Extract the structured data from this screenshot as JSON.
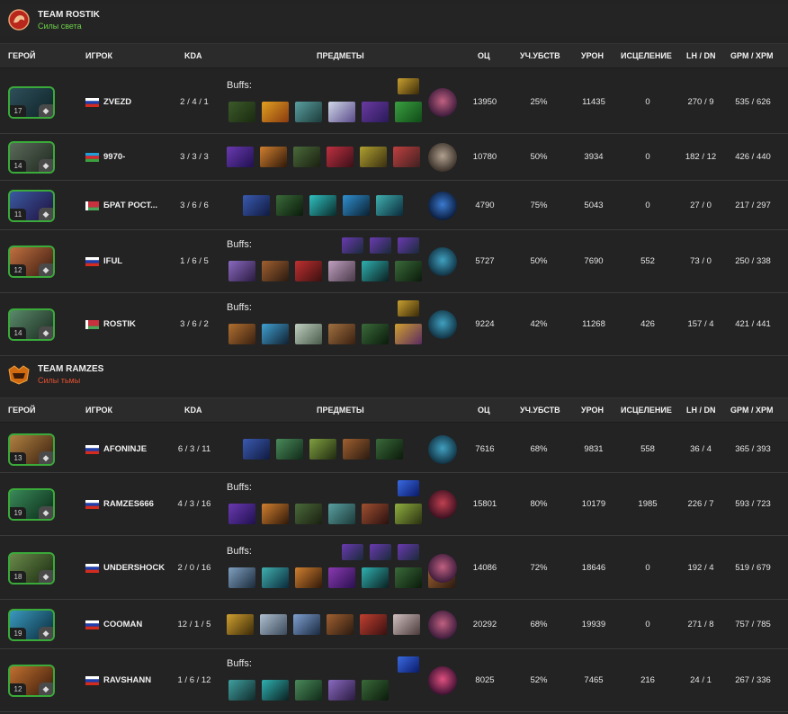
{
  "columns": {
    "hero": "ГЕРОЙ",
    "player": "ИГРОК",
    "kda": "KDA",
    "items": "ПРЕДМЕТЫ",
    "nw": "ОЦ",
    "part": "УЧ.УБСТВ",
    "dmg": "УРОН",
    "heal": "ИСЦЕЛЕНИЕ",
    "lhdn": "LH / DN",
    "gpm": "GPM / XPM"
  },
  "buffs_label": "Buffs:",
  "teams": [
    {
      "name": "TEAM ROSTIK",
      "side": "Силы света",
      "side_color": "#6ccf4a",
      "logo_icon": "rostik-team-logo-icon",
      "players": [
        {
          "level": "17",
          "role_icon": "hourglass-role-icon",
          "hero_colors": [
            "#2e4f5a",
            "#0f2328"
          ],
          "flag": "ru",
          "name": "ZVEZD",
          "kda": "2 / 4 / 1",
          "buffs": [
            "aghanim-shard-buff-icon"
          ],
          "items": [
            {
              "icon": "staff-item-icon",
              "c": [
                "#3c5a2a",
                "#1a2a10"
              ]
            },
            {
              "icon": "daedalus-item-icon",
              "c": [
                "#e0a020",
                "#8a3a10"
              ]
            },
            {
              "icon": "axe-item-icon",
              "c": [
                "#5aa0a0",
                "#1c3a3a"
              ]
            },
            {
              "icon": "blade-item-icon",
              "c": [
                "#d0d8e8",
                "#5a4a8a"
              ]
            },
            {
              "icon": "boots-item-icon",
              "c": [
                "#6a3aa0",
                "#2a1a5a"
              ]
            },
            {
              "icon": "sword-item-icon",
              "c": [
                "#3aa040",
                "#104a18"
              ]
            }
          ],
          "neutral": {
            "icon": "die-neutral-icon",
            "c": [
              "#c06080",
              "#3a1a3a"
            ]
          },
          "nw": "13950",
          "part": "25%",
          "dmg": "11435",
          "heal": "0",
          "lhdn": "270 / 9",
          "gpm": "535 / 626"
        },
        {
          "level": "14",
          "role_icon": "gear-role-icon",
          "hero_colors": [
            "#5a6a5a",
            "#202820"
          ],
          "flag": "az",
          "name": "9970-",
          "kda": "3 / 3 / 3",
          "buffs": [],
          "items": [
            {
              "icon": "boots-item-icon",
              "c": [
                "#6a3ab0",
                "#201050"
              ]
            },
            {
              "icon": "torch-item-icon",
              "c": [
                "#d08030",
                "#301808"
              ]
            },
            {
              "icon": "staff-item-icon",
              "c": [
                "#4a6a3a",
                "#1a2010"
              ]
            },
            {
              "icon": "mask-item-icon",
              "c": [
                "#c03040",
                "#3a1018"
              ]
            },
            {
              "icon": "helm-item-icon",
              "c": [
                "#b0a030",
                "#3a3010"
              ]
            },
            {
              "icon": "hammer-item-icon",
              "c": [
                "#c04040",
                "#402020"
              ]
            }
          ],
          "neutral": {
            "icon": "stone-neutral-icon",
            "c": [
              "#b0a090",
              "#3a3028"
            ]
          },
          "nw": "10780",
          "part": "50%",
          "dmg": "3934",
          "heal": "0",
          "lhdn": "182 / 12",
          "gpm": "426 / 440"
        },
        {
          "level": "11",
          "role_icon": "circle-role-icon",
          "hero_colors": [
            "#3a5aa0",
            "#201040"
          ],
          "flag": "by",
          "name": "БРАТ РОСТ...",
          "kda": "3 / 6 / 6",
          "buffs": [],
          "items": [
            {
              "icon": "boots-item-icon",
              "c": [
                "#3a5ab0",
                "#101a40"
              ]
            },
            {
              "icon": "staff-item-icon",
              "c": [
                "#3a6a3a",
                "#0a1a0a"
              ]
            },
            {
              "icon": "orb-item-icon",
              "c": [
                "#30c0c0",
                "#0a2a2a"
              ]
            },
            {
              "icon": "glimmer-item-icon",
              "c": [
                "#3090d0",
                "#0a2030"
              ]
            },
            {
              "icon": "wind-item-icon",
              "c": [
                "#40b0b0",
                "#0a2a3a"
              ]
            }
          ],
          "neutral": {
            "icon": "potion-neutral-icon",
            "c": [
              "#3a7ad0",
              "#0a1a3a"
            ]
          },
          "nw": "4790",
          "part": "75%",
          "dmg": "5043",
          "heal": "0",
          "lhdn": "27 / 0",
          "gpm": "217 / 297"
        },
        {
          "level": "12",
          "role_icon": "bar-role-icon",
          "hero_colors": [
            "#c07040",
            "#3a1a10"
          ],
          "flag": "ru",
          "name": "IFUL",
          "kda": "1 / 6 / 5",
          "buffs": [
            "rune-buff-icon",
            "orb-buff-icon",
            "mask-buff-icon"
          ],
          "items": [
            {
              "icon": "dagger-item-icon",
              "c": [
                "#8a6ac0",
                "#2a1a40"
              ]
            },
            {
              "icon": "boots-item-icon",
              "c": [
                "#a06030",
                "#2a1a10"
              ]
            },
            {
              "icon": "claw-item-icon",
              "c": [
                "#c03030",
                "#3a1010"
              ]
            },
            {
              "icon": "cloak-item-icon",
              "c": [
                "#c0a0c0",
                "#4a3a4a"
              ]
            },
            {
              "icon": "orb-item-icon",
              "c": [
                "#30b0b0",
                "#0a2020"
              ]
            },
            {
              "icon": "staff-item-icon",
              "c": [
                "#3a6a3a",
                "#0a1a0a"
              ]
            }
          ],
          "neutral": {
            "icon": "lantern-neutral-icon",
            "c": [
              "#40a0c0",
              "#103040"
            ]
          },
          "nw": "5727",
          "part": "50%",
          "dmg": "7690",
          "heal": "552",
          "lhdn": "73 / 0",
          "gpm": "250 / 338"
        },
        {
          "level": "14",
          "role_icon": "pen-role-icon",
          "hero_colors": [
            "#5a8a6a",
            "#1a2a20"
          ],
          "flag": "by",
          "name": "ROSTIK",
          "kda": "3 / 6 / 2",
          "buffs": [
            "aghanim-shard-buff-icon"
          ],
          "items": [
            {
              "icon": "boots-item-icon",
              "c": [
                "#b07030",
                "#3a2010"
              ]
            },
            {
              "icon": "gem-item-icon",
              "c": [
                "#40a0d0",
                "#102030"
              ]
            },
            {
              "icon": "scroll-item-icon",
              "c": [
                "#c0d0c0",
                "#4a5a4a"
              ]
            },
            {
              "icon": "belt-item-icon",
              "c": [
                "#a07040",
                "#3a2010"
              ]
            },
            {
              "icon": "staff-item-icon",
              "c": [
                "#3a6a3a",
                "#0a1a0a"
              ]
            },
            {
              "icon": "bottle-item-icon",
              "c": [
                "#d0a030",
                "#5a2a60"
              ]
            }
          ],
          "neutral": {
            "icon": "lantern-neutral-icon",
            "c": [
              "#40a0c0",
              "#103040"
            ]
          },
          "nw": "9224",
          "part": "42%",
          "dmg": "11268",
          "heal": "426",
          "lhdn": "157 / 4",
          "gpm": "421 / 441"
        }
      ]
    },
    {
      "name": "TEAM RAMZES",
      "side": "Силы тьмы",
      "side_color": "#e05030",
      "logo_icon": "ramzes-team-logo-icon",
      "players": [
        {
          "level": "13",
          "role_icon": "fire-role-icon",
          "hero_colors": [
            "#b08040",
            "#3a2010"
          ],
          "flag": "ru",
          "name": "AFONINJE",
          "kda": "6 / 3 / 11",
          "buffs": [],
          "items": [
            {
              "icon": "boots-item-icon",
              "c": [
                "#3a5ab0",
                "#101a40"
              ]
            },
            {
              "icon": "shield-item-icon",
              "c": [
                "#4a8a5a",
                "#102a18"
              ]
            },
            {
              "icon": "helm-item-icon",
              "c": [
                "#80a040",
                "#202a10"
              ]
            },
            {
              "icon": "boots-item-icon",
              "c": [
                "#a06030",
                "#2a1a10"
              ]
            },
            {
              "icon": "staff-item-icon",
              "c": [
                "#3a6a3a",
                "#0a1a0a"
              ]
            }
          ],
          "neutral": {
            "icon": "lantern-neutral-icon",
            "c": [
              "#40a0c0",
              "#103040"
            ]
          },
          "nw": "7616",
          "part": "68%",
          "dmg": "9831",
          "heal": "558",
          "lhdn": "36 / 4",
          "gpm": "365 / 393"
        },
        {
          "level": "19",
          "role_icon": "climb-role-icon",
          "hero_colors": [
            "#3a8a5a",
            "#0a2a18"
          ],
          "flag": "ru",
          "name": "RAMZES666",
          "kda": "4 / 3 / 16",
          "buffs": [
            "scepter-buff-icon"
          ],
          "items": [
            {
              "icon": "boots-item-icon",
              "c": [
                "#6a3ab0",
                "#201050"
              ]
            },
            {
              "icon": "torch-item-icon",
              "c": [
                "#d08030",
                "#301808"
              ]
            },
            {
              "icon": "staff-item-icon",
              "c": [
                "#4a6a3a",
                "#1a2010"
              ]
            },
            {
              "icon": "axe-item-icon",
              "c": [
                "#5aa0a0",
                "#1c3a3a"
              ]
            },
            {
              "icon": "mask-item-icon",
              "c": [
                "#a05030",
                "#2a1010"
              ]
            },
            {
              "icon": "helm-item-icon",
              "c": [
                "#90b040",
                "#2a3010"
              ]
            }
          ],
          "neutral": {
            "icon": "cape-neutral-icon",
            "c": [
              "#c04050",
              "#3a1020"
            ]
          },
          "nw": "15801",
          "part": "80%",
          "dmg": "10179",
          "heal": "1985",
          "lhdn": "226 / 7",
          "gpm": "593 / 723"
        },
        {
          "level": "18",
          "role_icon": "leaf-role-icon",
          "hero_colors": [
            "#6a8a4a",
            "#1a2a10"
          ],
          "flag": "ru",
          "name": "UNDERSHOCK",
          "kda": "2 / 0 / 16",
          "buffs": [
            "claw-buff-icon",
            "hammer-buff-icon",
            "gem-buff-icon"
          ],
          "items": [
            {
              "icon": "mace-item-icon",
              "c": [
                "#80a0c0",
                "#1a2a3a"
              ]
            },
            {
              "icon": "wind-item-icon",
              "c": [
                "#40b0b0",
                "#0a2a3a"
              ]
            },
            {
              "icon": "torch-item-icon",
              "c": [
                "#d08030",
                "#301808"
              ]
            },
            {
              "icon": "blade-item-icon",
              "c": [
                "#8a3ab0",
                "#2a1050"
              ]
            },
            {
              "icon": "orb-item-icon",
              "c": [
                "#30b0b0",
                "#0a2020"
              ]
            },
            {
              "icon": "staff-item-icon",
              "c": [
                "#3a6a3a",
                "#0a1a0a"
              ]
            },
            {
              "icon": "boots-item-icon",
              "c": [
                "#a06030",
                "#2a1a10"
              ]
            }
          ],
          "neutral": {
            "icon": "die-neutral-icon",
            "c": [
              "#c06080",
              "#3a1a3a"
            ]
          },
          "nw": "14086",
          "part": "72%",
          "dmg": "18646",
          "heal": "0",
          "lhdn": "192 / 4",
          "gpm": "519 / 679"
        },
        {
          "level": "19",
          "role_icon": "check-role-icon",
          "hero_colors": [
            "#3a9ac0",
            "#0a2a3a"
          ],
          "flag": "ru",
          "name": "COOMAN",
          "kda": "12 / 1 / 5",
          "buffs": [],
          "items": [
            {
              "icon": "helm-item-icon",
              "c": [
                "#d0a030",
                "#3a2a08"
              ]
            },
            {
              "icon": "orb-item-icon",
              "c": [
                "#b0c0d0",
                "#3a4a5a"
              ]
            },
            {
              "icon": "blade-item-icon",
              "c": [
                "#80a0d0",
                "#1a2a40"
              ]
            },
            {
              "icon": "boots-item-icon",
              "c": [
                "#a06030",
                "#2a1a10"
              ]
            },
            {
              "icon": "claw-item-icon",
              "c": [
                "#c04030",
                "#3a1010"
              ]
            },
            {
              "icon": "mask-item-icon",
              "c": [
                "#d0c0c0",
                "#4a3a3a"
              ]
            }
          ],
          "neutral": {
            "icon": "die-neutral-icon",
            "c": [
              "#c06080",
              "#3a1a3a"
            ]
          },
          "nw": "20292",
          "part": "68%",
          "dmg": "19939",
          "heal": "0",
          "lhdn": "271 / 8",
          "gpm": "757 / 785"
        },
        {
          "level": "12",
          "role_icon": "flask-role-icon",
          "hero_colors": [
            "#c07030",
            "#3a1a0a"
          ],
          "flag": "ru",
          "name": "RAVSHANN",
          "kda": "1 / 6 / 12",
          "buffs": [
            "scepter-buff-icon"
          ],
          "items": [
            {
              "icon": "lantern-item-icon",
              "c": [
                "#40a0a0",
                "#102a2a"
              ]
            },
            {
              "icon": "orb-item-icon",
              "c": [
                "#30b0b0",
                "#0a2020"
              ]
            },
            {
              "icon": "shield-item-icon",
              "c": [
                "#4a8a5a",
                "#102a18"
              ]
            },
            {
              "icon": "dagger-item-icon",
              "c": [
                "#8a6ac0",
                "#2a1a40"
              ]
            },
            {
              "icon": "staff-item-icon",
              "c": [
                "#3a6a3a",
                "#0a1a0a"
              ]
            }
          ],
          "neutral": {
            "icon": "flower-neutral-icon",
            "c": [
              "#e05080",
              "#3a1030"
            ]
          },
          "nw": "8025",
          "part": "52%",
          "dmg": "7465",
          "heal": "216",
          "lhdn": "24 / 1",
          "gpm": "267 / 336"
        }
      ]
    }
  ]
}
